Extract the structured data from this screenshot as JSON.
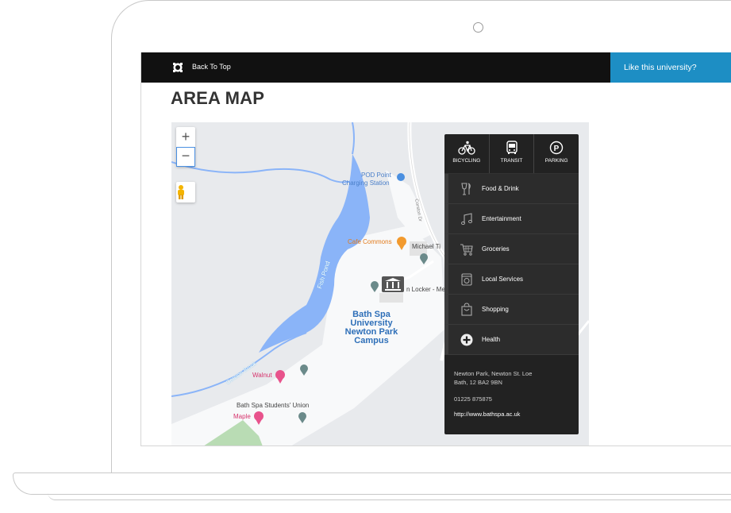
{
  "topbar": {
    "back_to_top": "Back To Top",
    "cta": "Like this university?"
  },
  "section": {
    "title": "AREA MAP"
  },
  "map": {
    "zoom_in": "+",
    "zoom_out": "−",
    "labels": {
      "pod_point": "POD Point",
      "charging_station": "Charging Station",
      "cafe_commons": "Cafe Commons",
      "michael": "Michael Ti",
      "locker": "n Locker - Me",
      "fish_pond": "Fish Pond",
      "coston_brook": "Corston Brook",
      "walnut": "Walnut",
      "students_union": "Bath Spa Students' Union",
      "maple": "Maple",
      "campus_line1": "Bath Spa",
      "campus_line2": "University",
      "campus_line3": "Newton Park",
      "campus_line4": "Campus",
      "corston_dr": "Corston Dr"
    }
  },
  "panel": {
    "tabs": [
      {
        "label": "BICYCLING",
        "icon": "bicycle-icon"
      },
      {
        "label": "TRANSIT",
        "icon": "bus-icon"
      },
      {
        "label": "PARKING",
        "icon": "parking-icon"
      }
    ],
    "items": [
      {
        "label": "Food & Drink",
        "icon": "food-drink-icon"
      },
      {
        "label": "Entertainment",
        "icon": "music-note-icon"
      },
      {
        "label": "Groceries",
        "icon": "cart-icon"
      },
      {
        "label": "Local Services",
        "icon": "local-services-icon"
      },
      {
        "label": "Shopping",
        "icon": "shopping-bag-icon"
      },
      {
        "label": "Health",
        "icon": "health-plus-icon"
      }
    ],
    "address_line1": "Newton Park, Newton St. Loe",
    "address_line2": "Bath, 12 BA2 9BN",
    "phone": "01225 875875",
    "url": "http://www.bathspa.ac.uk"
  },
  "colors": {
    "topbar": "#111111",
    "cta": "#1d8ec4",
    "panel": "#222222",
    "water": "#8ab4f8"
  }
}
